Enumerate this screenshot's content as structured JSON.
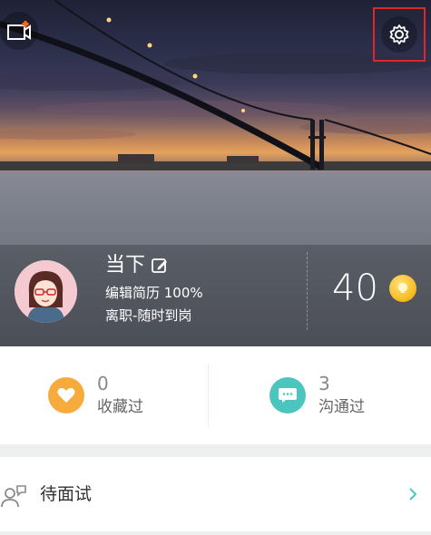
{
  "profile": {
    "name": "当下",
    "resume_line": "编辑简历 100%",
    "status_line": "离职-随时到岗",
    "coins": "40"
  },
  "stats": [
    {
      "count": "0",
      "label": "收藏过",
      "icon": "heart-icon",
      "color": "#f6ab3c"
    },
    {
      "count": "3",
      "label": "沟通过",
      "icon": "chat-bubble-icon",
      "color": "#4cc5be"
    }
  ],
  "list": [
    {
      "label": "待面试",
      "icon": "interview-person-icon"
    }
  ],
  "colors": {
    "highlight_box": "#e0262a",
    "coin": "#f5b81d"
  }
}
